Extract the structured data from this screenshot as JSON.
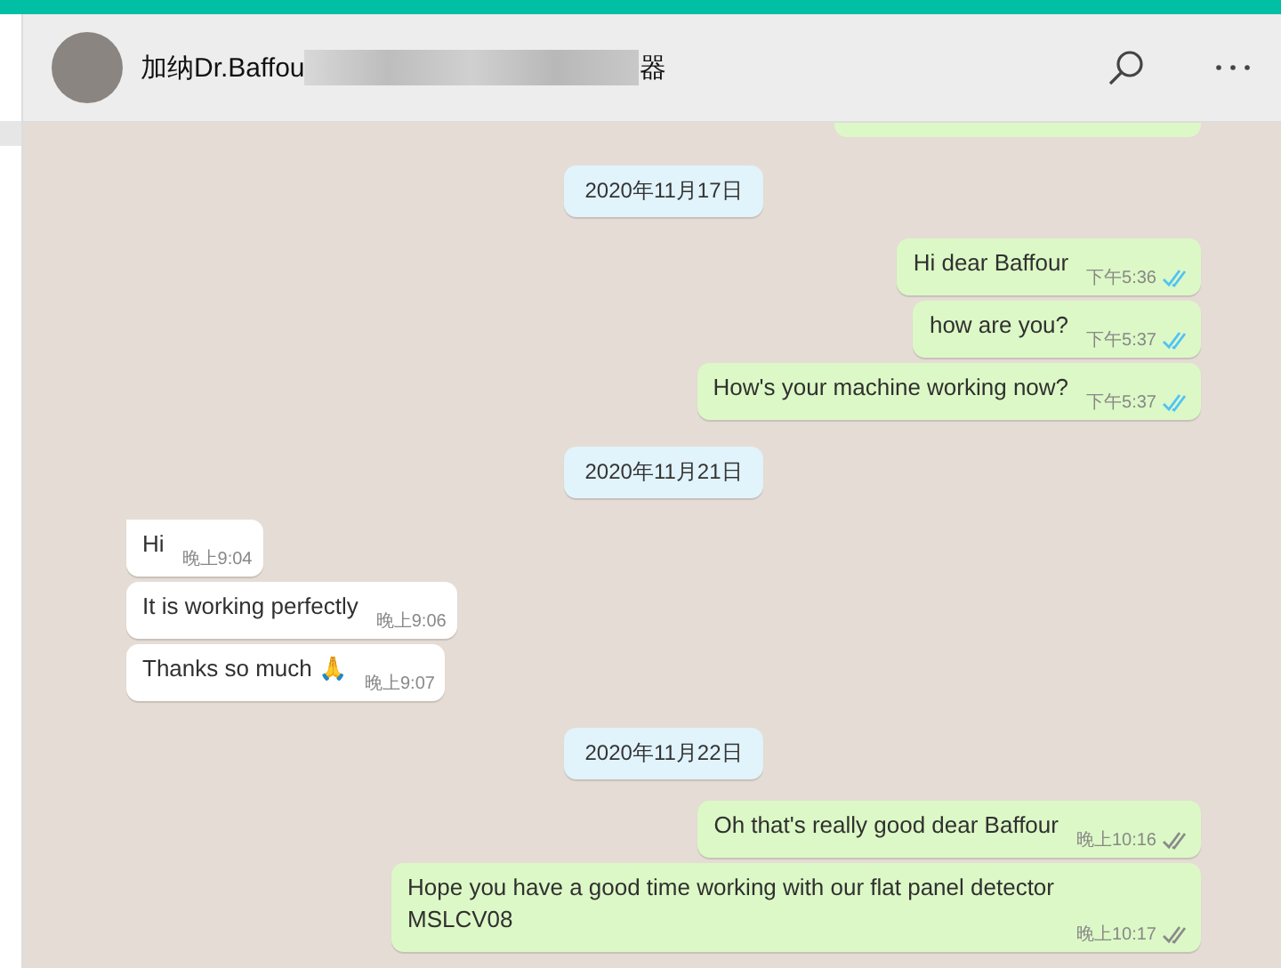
{
  "header": {
    "title_start": "加纳Dr.Baffou",
    "title_end": "器"
  },
  "messages": [
    {
      "kind": "date",
      "text": "2020年11月17日"
    },
    {
      "kind": "out",
      "text": "Hi dear Baffour",
      "time": "下午5:36",
      "read": true
    },
    {
      "kind": "out",
      "text": "how are you?",
      "time": "下午5:37",
      "read": true
    },
    {
      "kind": "out",
      "text": "How's your machine working now?",
      "time": "下午5:37",
      "read": true
    },
    {
      "kind": "date",
      "text": "2020年11月21日"
    },
    {
      "kind": "in",
      "text": "Hi",
      "time": "晚上9:04",
      "tail": true
    },
    {
      "kind": "in",
      "text": "It is working perfectly",
      "time": "晚上9:06",
      "tail": false
    },
    {
      "kind": "in",
      "text": "Thanks  so much 🙏",
      "time": "晚上9:07",
      "tail": false
    },
    {
      "kind": "date",
      "text": "2020年11月22日"
    },
    {
      "kind": "out",
      "text": "Oh that's really good dear Baffour",
      "time": "晚上10:16",
      "read": false
    },
    {
      "kind": "out",
      "text": "Hope you have a good time working with our flat panel detector MSLCV08",
      "time": "晚上10:17",
      "read": false
    }
  ]
}
